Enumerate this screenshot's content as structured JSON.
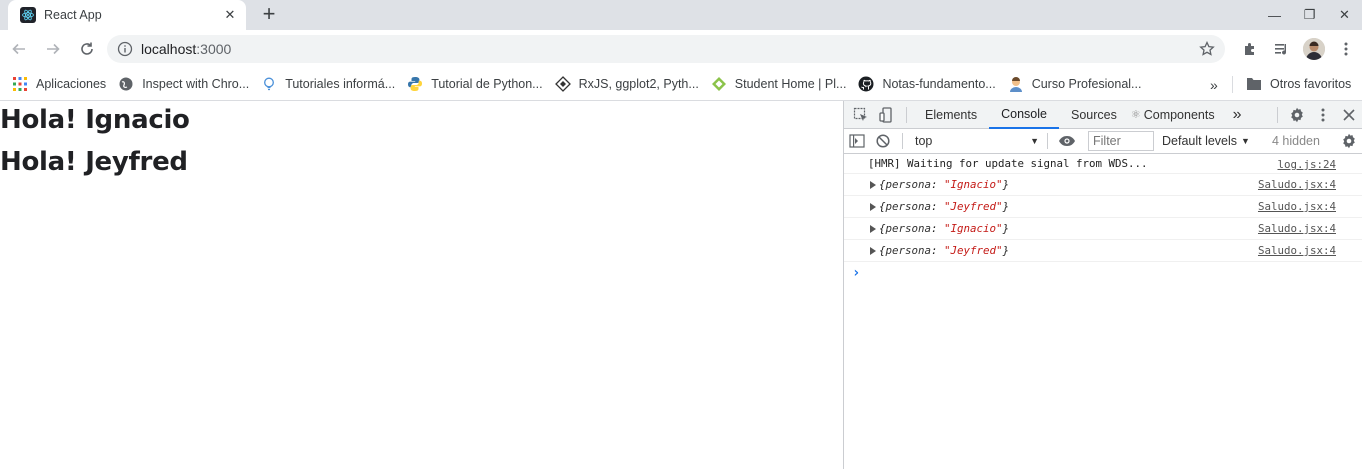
{
  "browser": {
    "tab": {
      "title": "React App",
      "close": "✕",
      "favicon": "react-logo-icon"
    },
    "new_tab": "+",
    "window_controls": {
      "minimize": "—",
      "restore": "❐",
      "close": "✕"
    },
    "address": {
      "host": "localhost",
      "port": ":3000"
    },
    "bookmarks": [
      {
        "label": "Aplicaciones",
        "icon": "apps-grid-icon"
      },
      {
        "label": "Inspect with Chro...",
        "icon": "globe-icon"
      },
      {
        "label": "Tutoriales informá...",
        "icon": "bulb-icon"
      },
      {
        "label": "Tutorial de Python...",
        "icon": "python-icon"
      },
      {
        "label": "RxJS, ggplot2, Pyth...",
        "icon": "diamond-icon"
      },
      {
        "label": "Student Home | Pl...",
        "icon": "pluralsight-icon"
      },
      {
        "label": "Notas-fundamento...",
        "icon": "github-icon"
      },
      {
        "label": "Curso Profesional...",
        "icon": "person-icon"
      }
    ],
    "bookmarks_more": "»",
    "other_bookmarks": "Otros favoritos"
  },
  "page": {
    "headings": [
      "Hola! Ignacio",
      "Hola! Jeyfred"
    ]
  },
  "devtools": {
    "tabs": [
      "Elements",
      "Console",
      "Sources",
      "Components"
    ],
    "active_tab": "Console",
    "more_tabs": "»",
    "context": "top",
    "filter_placeholder": "Filter",
    "levels": "Default levels",
    "hidden": "4 hidden",
    "messages": [
      {
        "text": "[HMR] Waiting for update signal from WDS...",
        "source": "log.js:24"
      },
      {
        "key": "persona",
        "value": "\"Ignacio\"",
        "source": "Saludo.jsx:4"
      },
      {
        "key": "persona",
        "value": "\"Jeyfred\"",
        "source": "Saludo.jsx:4"
      },
      {
        "key": "persona",
        "value": "\"Ignacio\"",
        "source": "Saludo.jsx:4"
      },
      {
        "key": "persona",
        "value": "\"Jeyfred\"",
        "source": "Saludo.jsx:4"
      }
    ],
    "prompt": "›"
  },
  "colors": {
    "accent": "#1a73e8",
    "string": "#c41a16",
    "tabstrip": "#dee1e6"
  }
}
